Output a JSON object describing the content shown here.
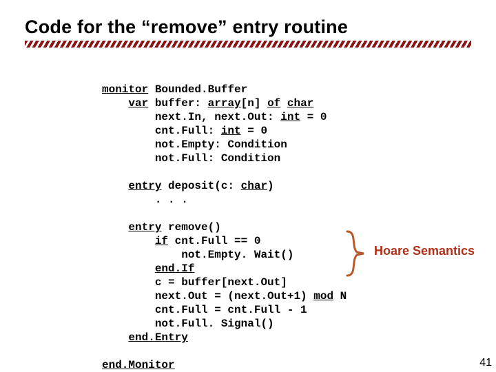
{
  "title": "Code for the “remove” entry routine",
  "code": {
    "l1a": "monitor",
    "l1b": " Bounded.Buffer",
    "l2a": "    ",
    "l2b": "var",
    "l2c": " buffer: ",
    "l2d": "array",
    "l2e": "[n] ",
    "l2f": "of",
    "l2g": " ",
    "l2h": "char",
    "l3": "        next.In, next.Out: ",
    "l3b": "int",
    "l3c": " = 0",
    "l4": "        cnt.Full: ",
    "l4b": "int",
    "l4c": " = 0",
    "l5": "        not.Empty: Condition",
    "l6": "        not.Full: Condition",
    "blank1": "",
    "l7a": "    ",
    "l7b": "entry",
    "l7c": " deposit(c: ",
    "l7d": "char",
    "l7e": ")",
    "l8": "        . . .",
    "blank2": "",
    "l9a": "    ",
    "l9b": "entry",
    "l9c": " remove()",
    "l10a": "        ",
    "l10b": "if",
    "l10c": " cnt.Full == 0",
    "l11": "            not.Empty. Wait()",
    "l12a": "        ",
    "l12b": "end.If",
    "l13": "        c = buffer[next.Out]",
    "l14": "        next.Out = (next.Out+1) ",
    "l14b": "mod",
    "l14c": " N",
    "l15": "        cnt.Full = cnt.Full - 1",
    "l16": "        not.Full. Signal()",
    "l17a": "    ",
    "l17b": "end.Entry",
    "blank3": "",
    "l18": "end.Monitor"
  },
  "callout": "Hoare Semantics",
  "page_number": "41"
}
